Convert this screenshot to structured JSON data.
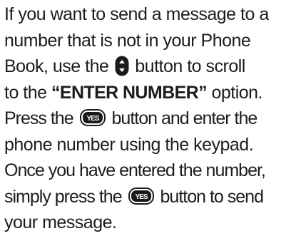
{
  "paragraph": {
    "line1": "If you want to send a message to a",
    "line2": "number that is not in your Phone",
    "line3_before": "Book, use the ",
    "line3_after": " button to scroll",
    "line4_before": "to the ",
    "line4_bold": "“ENTER NUMBER”",
    "line4_after": " option.",
    "line5_before": "Press the ",
    "line5_after": " button and enter the",
    "line6": "phone number using the keypad.",
    "line7": "Once you have entered the number,",
    "line8_before": "simply press the ",
    "line8_after": " button to send",
    "line9": "your message."
  },
  "icons": {
    "scroll_key": "scroll-key-icon",
    "yes_key_label": "YES"
  }
}
